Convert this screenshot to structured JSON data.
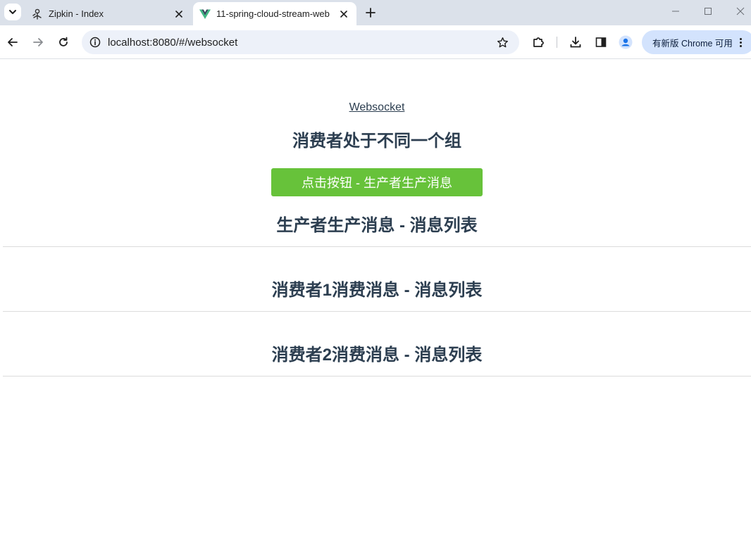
{
  "browser": {
    "tabs": [
      {
        "title": "Zipkin - Index",
        "active": false
      },
      {
        "title": "11-spring-cloud-stream-web",
        "active": true
      }
    ],
    "url": "localhost:8080/#/websocket",
    "update_label": "有新版 Chrome 可用"
  },
  "page": {
    "nav_link": "Websocket",
    "group_title": "消费者处于不同一个组",
    "produce_button": "点击按钮 - 生产者生产消息",
    "producer_list_title": "生产者生产消息 - 消息列表",
    "consumer1_list_title": "消费者1消费消息 - 消息列表",
    "consumer2_list_title": "消费者2消费消息 - 消息列表"
  },
  "colors": {
    "button_green": "#67c23a",
    "heading_text": "#2c3e50",
    "tabstrip_bg": "#dbe1ea",
    "omnibox_bg": "#edf1f9",
    "update_pill_bg": "#d3e3fd"
  },
  "icons": [
    "tab-search-icon",
    "zipkin-icon",
    "vue-icon",
    "close-icon",
    "plus-icon",
    "minimize-icon",
    "maximize-icon",
    "window-close-icon",
    "back-arrow-icon",
    "forward-arrow-icon",
    "reload-icon",
    "info-icon",
    "star-icon",
    "extensions-icon",
    "download-icon",
    "side-panel-icon",
    "profile-icon",
    "kebab-menu-icon"
  ]
}
